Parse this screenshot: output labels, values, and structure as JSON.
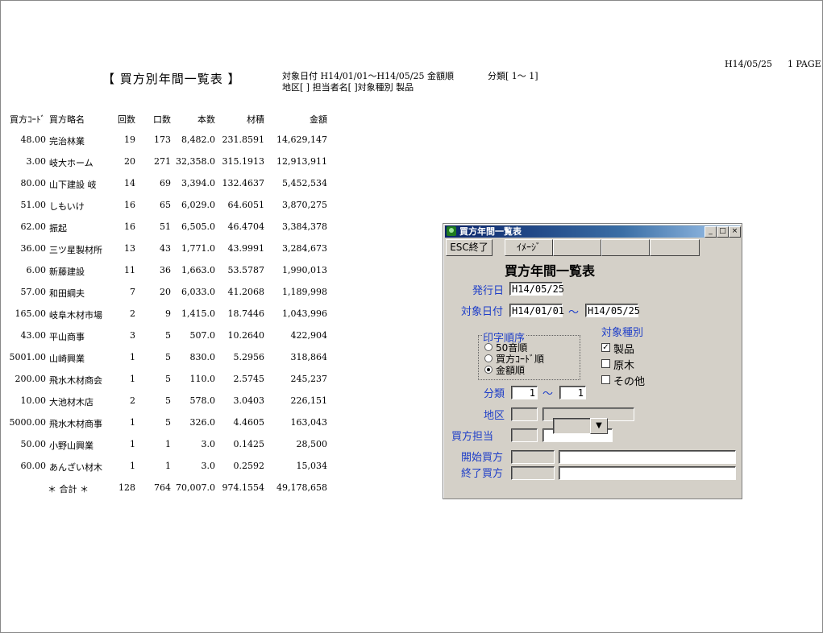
{
  "report": {
    "date": "H14/05/25",
    "page": "1 PAGE",
    "title": "【 買方別年間一覧表 】",
    "condition_line1": "対象日付 H14/01/01～H14/05/25 金額順",
    "classification": "分類[ 1～ 1]",
    "condition_line2": "地区[ ] 担当者名[ ]対象種別 製品",
    "headers": [
      "買方ｺｰﾄﾞ",
      "買方略名",
      "回数",
      "口数",
      "本数",
      "材積",
      "金額"
    ],
    "rows": [
      [
        "48.00",
        "完治林業",
        "19",
        "173",
        "8,482.0",
        "231.8591",
        "14,629,147"
      ],
      [
        "3.00",
        "岐大ホーム",
        "20",
        "271",
        "32,358.0",
        "315.1913",
        "12,913,911"
      ],
      [
        "80.00",
        "山下建設 岐",
        "14",
        "69",
        "3,394.0",
        "132.4637",
        "5,452,534"
      ],
      [
        "51.00",
        "しもいけ",
        "16",
        "65",
        "6,029.0",
        "64.6051",
        "3,870,275"
      ],
      [
        "62.00",
        "振起",
        "16",
        "51",
        "6,505.0",
        "46.4704",
        "3,384,378"
      ],
      [
        "36.00",
        "三ツ星製材所",
        "13",
        "43",
        "1,771.0",
        "43.9991",
        "3,284,673"
      ],
      [
        "6.00",
        "新藤建設",
        "11",
        "36",
        "1,663.0",
        "53.5787",
        "1,990,013"
      ],
      [
        "57.00",
        "和田綱夫",
        "7",
        "20",
        "6,033.0",
        "41.2068",
        "1,189,998"
      ],
      [
        "165.00",
        "岐阜木材市場",
        "2",
        "9",
        "1,415.0",
        "18.7446",
        "1,043,996"
      ],
      [
        "43.00",
        "平山商事",
        "3",
        "5",
        "507.0",
        "10.2640",
        "422,904"
      ],
      [
        "5001.00",
        "山崎興業",
        "1",
        "5",
        "830.0",
        "5.2956",
        "318,864"
      ],
      [
        "200.00",
        "飛水木材商会",
        "1",
        "5",
        "110.0",
        "2.5745",
        "245,237"
      ],
      [
        "10.00",
        "大池材木店",
        "2",
        "5",
        "578.0",
        "3.0403",
        "226,151"
      ],
      [
        "5000.00",
        "飛水木材商事",
        "1",
        "5",
        "326.0",
        "4.4605",
        "163,043"
      ],
      [
        "50.00",
        "小野山興業",
        "1",
        "1",
        "3.0",
        "0.1425",
        "28,500"
      ],
      [
        "60.00",
        "あんざい材木",
        "1",
        "1",
        "3.0",
        "0.2592",
        "15,034"
      ]
    ],
    "total": [
      "＊ 合計 ＊",
      "128",
      "764",
      "70,007.0",
      "974.1554",
      "49,178,658"
    ]
  },
  "dialog": {
    "window_title": "買方年間一覧表",
    "esc_button": "ESC終了",
    "image_button": "ｲﾒｰｼﾞ",
    "heading": "買方年間一覧表",
    "issue_date_label": "発行日",
    "issue_date_value": "H14/05/25",
    "target_date_label": "対象日付",
    "date_from": "H14/01/01",
    "tilde": "～",
    "date_to": "H14/05/25",
    "print_order_label": "印字順序",
    "print_order_options": [
      "50音順",
      "買方ｺｰﾄﾞ順",
      "金額順"
    ],
    "print_order_selected": "金額順",
    "target_type_label": "対象種別",
    "target_types": [
      {
        "label": "製品",
        "checked": true
      },
      {
        "label": "原木",
        "checked": false
      },
      {
        "label": "その他",
        "checked": false
      }
    ],
    "classification_label": "分類",
    "class_from": "1",
    "class_to": "1",
    "district_label": "地区",
    "buyer_staff_label": "買方担当",
    "start_buyer_label": "開始買方",
    "end_buyer_label": "終了買方"
  }
}
